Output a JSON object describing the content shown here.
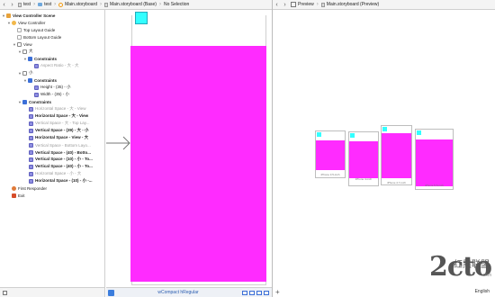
{
  "left_jumpbar": {
    "back": "‹",
    "forward": "›",
    "crumbs": [
      "test",
      "test",
      "Main.storyboard",
      "Main.storyboard (Base)",
      "No Selection"
    ]
  },
  "right_jumpbar": {
    "back": "‹",
    "forward": "›",
    "crumbs": [
      "Preview",
      "Main.storyboard (Preview)"
    ]
  },
  "outline": {
    "items": [
      {
        "label": "View Controller Scene",
        "style": "bold",
        "icon": "scene"
      },
      {
        "label": "View Controller",
        "style": "",
        "icon": "vc"
      },
      {
        "label": "Top Layout Guide",
        "style": "",
        "icon": "guide"
      },
      {
        "label": "Bottom Layout Guide",
        "style": "",
        "icon": "guide"
      },
      {
        "label": "View",
        "style": "",
        "icon": "view"
      },
      {
        "label": "大",
        "style": "",
        "icon": "view"
      },
      {
        "label": "Constraints",
        "style": "bold",
        "icon": "cons"
      },
      {
        "label": "Aspect Ratio - 大 - 大",
        "style": "grey",
        "icon": "item"
      },
      {
        "label": "小",
        "style": "",
        "icon": "view"
      },
      {
        "label": "Constraints",
        "style": "bold",
        "icon": "cons"
      },
      {
        "label": "Height - (35) - 小",
        "style": "",
        "icon": "item"
      },
      {
        "label": "Width - (35) - 小",
        "style": "",
        "icon": "item"
      },
      {
        "label": "Constraints",
        "style": "bold",
        "icon": "cons"
      },
      {
        "label": "Horizontal Space - 大 - View",
        "style": "grey",
        "icon": "item"
      },
      {
        "label": "Horizontal Space - 大 - View",
        "style": "bold",
        "icon": "item"
      },
      {
        "label": "Vertical Space - 大 - Top Lay...",
        "style": "grey",
        "icon": "item"
      },
      {
        "label": "Vertical Space - (39) - 大 - 小",
        "style": "bold",
        "icon": "item"
      },
      {
        "label": "Horizontal Space - View - 大",
        "style": "bold",
        "icon": "item"
      },
      {
        "label": "Vertical Space - Bottom Layo...",
        "style": "grey",
        "icon": "item"
      },
      {
        "label": "Vertical Space - (40) - Botto...",
        "style": "bold",
        "icon": "item"
      },
      {
        "label": "Vertical Space - (10) - 小 - To...",
        "style": "bold",
        "icon": "item"
      },
      {
        "label": "Vertical Space - (40) - 小 - To...",
        "style": "bold",
        "icon": "item"
      },
      {
        "label": "Horizontal Space - 小 - 大",
        "style": "grey",
        "icon": "item"
      },
      {
        "label": "Horizontal Space - (10) - 小 -...",
        "style": "bold",
        "icon": "item"
      },
      {
        "label": "First Responder",
        "style": "",
        "icon": "fr"
      },
      {
        "label": "Exit",
        "style": "",
        "icon": "exit"
      }
    ]
  },
  "canvas_bottom": {
    "size_class": "wCompact hRegular"
  },
  "preview": {
    "device_labels": [
      "iPhone 3.5-inch",
      "iPhone 4-inch",
      "iPhone 4.7-inch",
      "iPhone 5.5-inch"
    ]
  },
  "watermark": {
    "logo": "2cto",
    "cn": "红黑联盟",
    "url": ".com"
  },
  "language": "English",
  "colors": {
    "view_background": "#ff2bff",
    "small_view": "#33ffff"
  }
}
